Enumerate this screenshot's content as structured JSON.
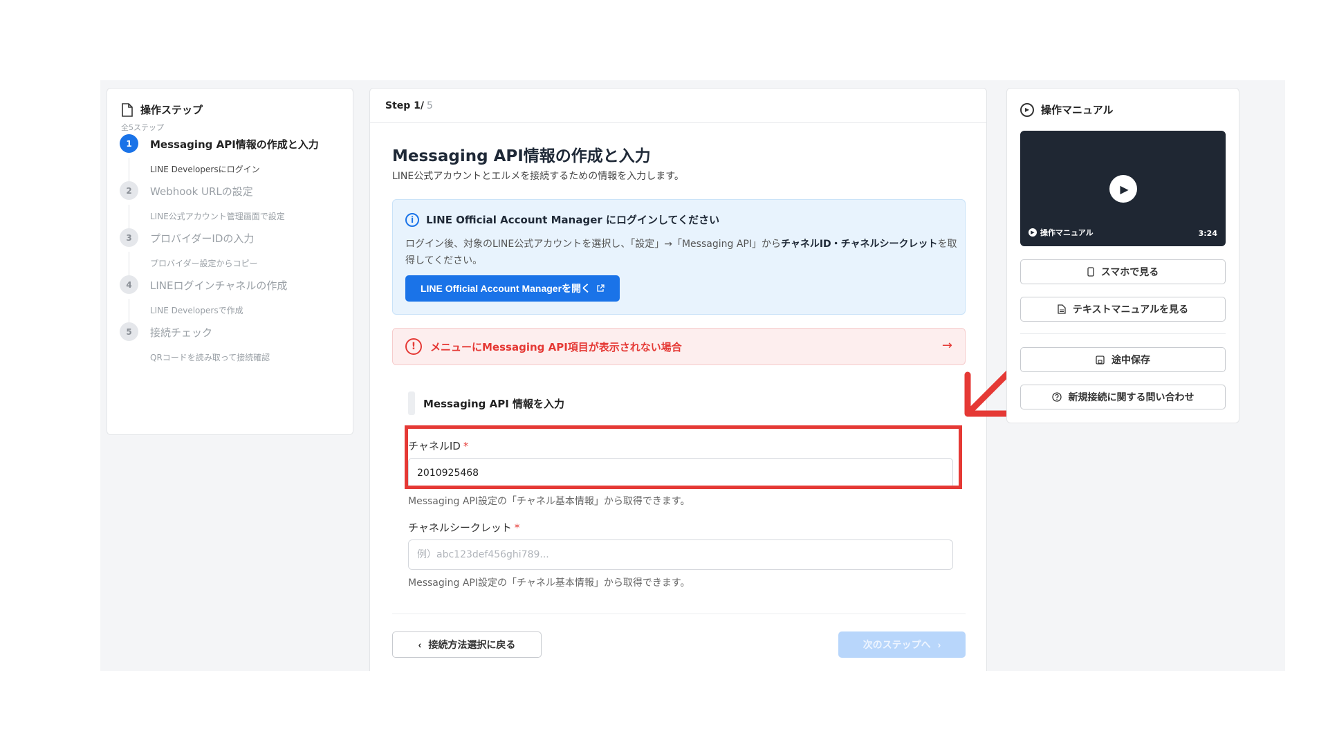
{
  "steps_panel": {
    "title": "操作ステップ",
    "subtitle": "全5ステップ",
    "items": [
      {
        "num": "1",
        "title": "Messaging API情報の作成と入力",
        "desc": "LINE Developersにログイン",
        "active": true
      },
      {
        "num": "2",
        "title": "Webhook URLの設定",
        "desc": "LINE公式アカウント管理画面で設定",
        "active": false
      },
      {
        "num": "3",
        "title": "プロバイダーIDの入力",
        "desc": "プロバイダー設定からコピー",
        "active": false
      },
      {
        "num": "4",
        "title": "LINEログインチャネルの作成",
        "desc": "LINE Developersで作成",
        "active": false
      },
      {
        "num": "5",
        "title": "接続チェック",
        "desc": "QRコードを読み取って接続確認",
        "active": false
      }
    ]
  },
  "main": {
    "step_label": "Step 1/",
    "step_total": "5",
    "heading": "Messaging API情報の作成と入力",
    "lead": "LINE公式アカウントとエルメを接続するための情報を入力します。",
    "info": {
      "title": "LINE Official Account Manager にログインしてください",
      "body_prefix": "ログイン後、対象のLINE公式アカウントを選択し、「設定」→「Messaging API」から",
      "body_bold": "チャネルID・チャネルシークレット",
      "body_suffix": "を取得してください。",
      "button_label": "LINE Official Account Managerを開く",
      "icon": "info-icon"
    },
    "warning": {
      "text": "メニューにMessaging API項目が表示されない場合",
      "icon": "alert-icon"
    },
    "section_title": "Messaging API 情報を入力",
    "channel_id": {
      "label": "チャネルID",
      "required_mark": "*",
      "value": "2010925468",
      "help": "Messaging API設定の「チャネル基本情報」から取得できます。"
    },
    "channel_secret": {
      "label": "チャネルシークレット",
      "required_mark": "*",
      "placeholder": "例）abc123def456ghi789...",
      "help": "Messaging API設定の「チャネル基本情報」から取得できます。"
    },
    "back_button": "接続方法選択に戻る",
    "next_button": "次のステップへ"
  },
  "manual": {
    "title": "操作マニュアル",
    "video_label": "操作マニュアル",
    "video_duration": "3:24",
    "buttons": {
      "phone": "スマホで見る",
      "text_manual": "テキストマニュアルを見る",
      "save": "途中保存",
      "contact": "新規接続に関する問い合わせ"
    }
  },
  "colors": {
    "accent": "#1a73e8",
    "highlight": "#e53935",
    "warning_bg": "#fdeeee",
    "info_bg": "#e8f3fd"
  }
}
